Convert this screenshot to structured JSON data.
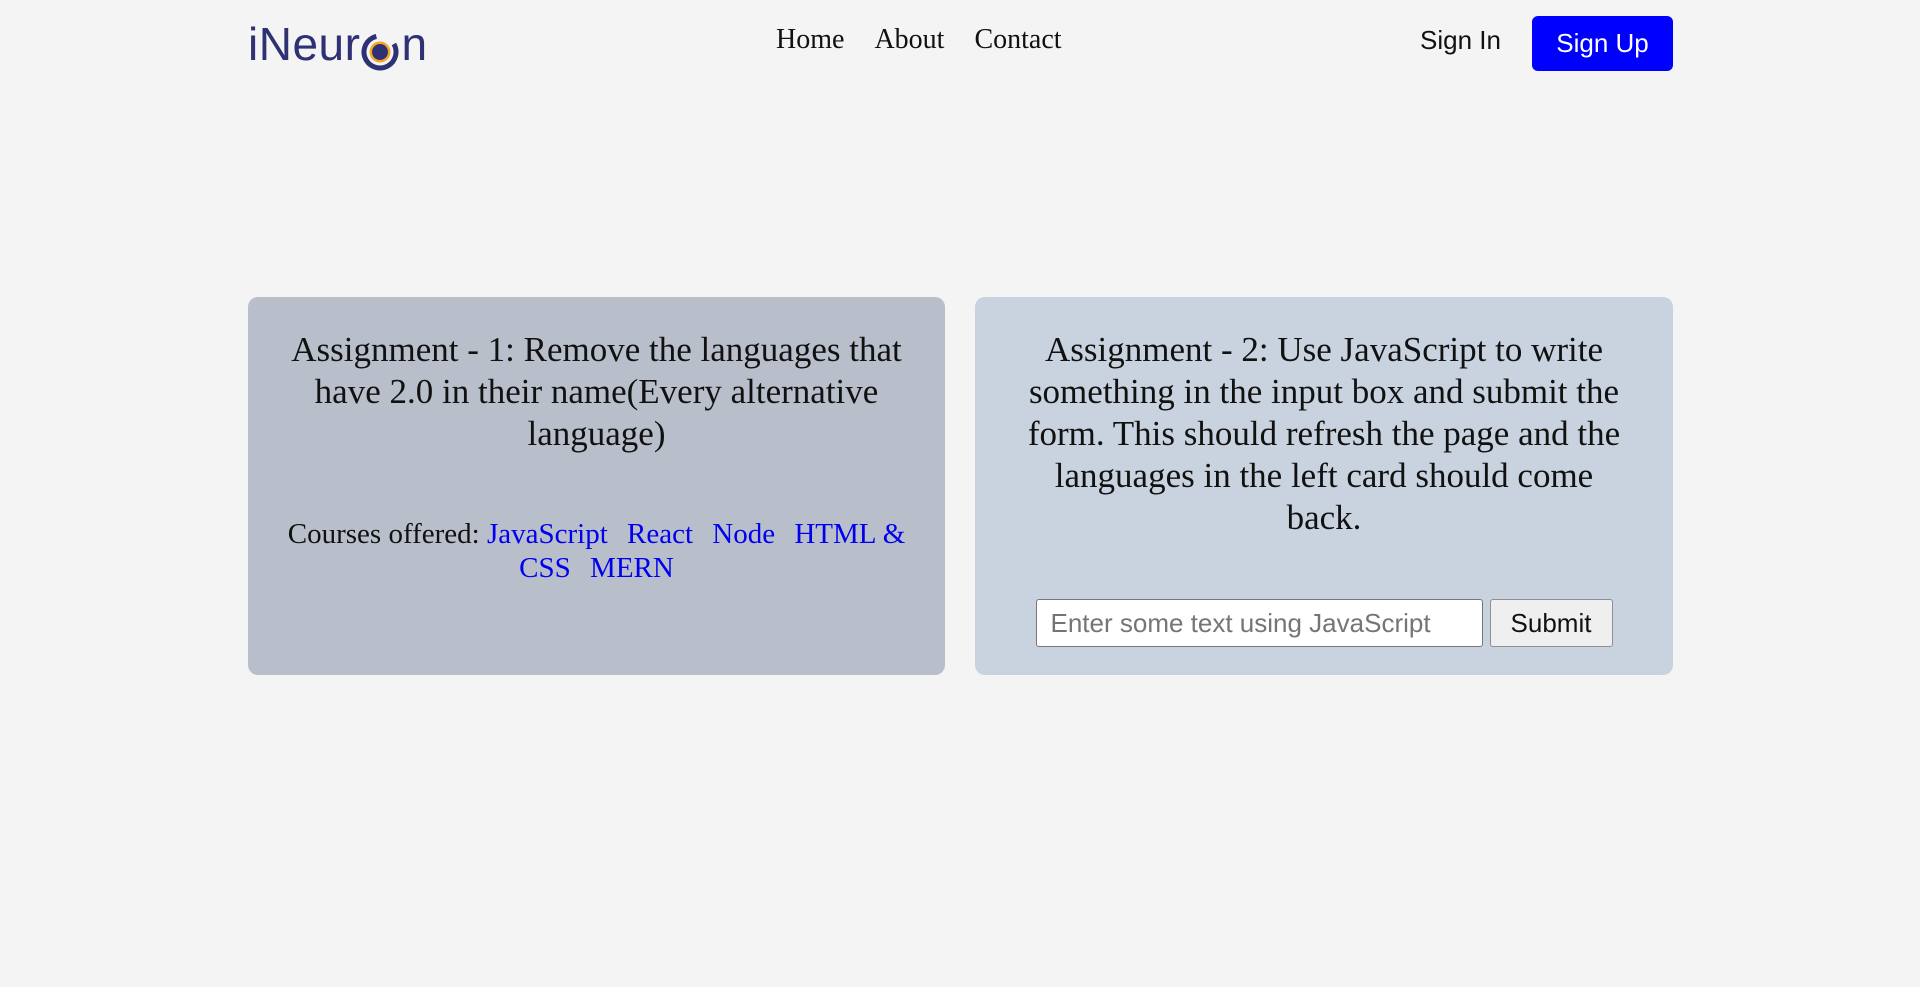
{
  "header": {
    "logo": {
      "text_before": "iNeur",
      "text_after": "n",
      "icon": "neuron-o-icon",
      "colors": {
        "text": "#2e3173",
        "ring_outer": "#2e3173",
        "ring_inner": "#f5a623"
      }
    },
    "nav": [
      {
        "label": "Home"
      },
      {
        "label": "About"
      },
      {
        "label": "Contact"
      }
    ],
    "sign_in_label": "Sign In",
    "sign_up_label": "Sign Up",
    "accent_color": "#0000ff"
  },
  "assignment1": {
    "title": "Assignment - 1: Remove the languages that have 2.0 in their name(Every alternative language)",
    "courses_label": "Courses offered:",
    "courses": [
      "JavaScript",
      "React",
      "Node",
      "HTML & CSS",
      "MERN"
    ],
    "background": "#b8bfca"
  },
  "assignment2": {
    "title": "Assignment - 2: Use JavaScript to write something in the input box and submit the form. This should refresh the page and the languages in the left card should come back.",
    "input_placeholder": "Enter some text using JavaScript",
    "input_value": "",
    "submit_label": "Submit",
    "background": "#c8d3df"
  }
}
